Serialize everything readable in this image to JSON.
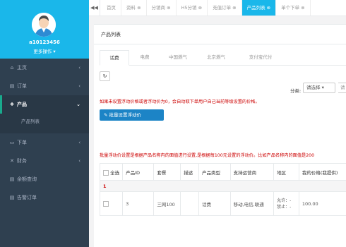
{
  "sidebar": {
    "username": "a10123456",
    "more_ops": "更多操作 ▾",
    "items": [
      {
        "icon": "home-icon",
        "glyph": "⌂",
        "label": "主页",
        "arrow": "‹"
      },
      {
        "icon": "order-icon",
        "glyph": "▤",
        "label": "订单",
        "arrow": "‹"
      },
      {
        "icon": "cube-icon",
        "glyph": "❖",
        "label": "产品",
        "arrow": "⌄"
      },
      {
        "icon": "download-icon",
        "glyph": "▭",
        "label": "下单",
        "arrow": "‹"
      },
      {
        "icon": "finance-icon",
        "glyph": "✕",
        "label": "财务",
        "arrow": "‹"
      },
      {
        "icon": "balance-icon",
        "glyph": "▤",
        "label": "余额查询",
        "arrow": ""
      },
      {
        "icon": "alert-icon",
        "glyph": "▤",
        "label": "告警订单",
        "arrow": ""
      }
    ],
    "sub_item": "产品列表"
  },
  "tabbar": {
    "back_glyph": "◀◀",
    "tabs": [
      {
        "label": "首页"
      },
      {
        "label": "资料 ⊗"
      },
      {
        "label": "分销商 ⊗"
      },
      {
        "label": "H5分销 ⊗"
      },
      {
        "label": "充值订单 ⊗"
      },
      {
        "label": "产品列表 ⊗"
      },
      {
        "label": "单个下单 ⊗"
      }
    ]
  },
  "panel": {
    "title": "产品列表",
    "subtabs": [
      "话费",
      "电费",
      "中国燃气",
      "北京燃气",
      "支付宝代付"
    ],
    "refresh_glyph": "↻",
    "filter_label": "分类:",
    "filter_select": "请选择 ▾",
    "filter_input": "请",
    "notice1": "如果未设置浮动价格或者浮动价为0，会自动取下单用户自己当前等级设置的价格。",
    "float_button": "✎ 批量设置浮动价",
    "notice2": "批量浮动价设置是根据产品名称内的面值进行设置,是根据每100元设置的浮动价。比如产品名称内的面值是200"
  },
  "table": {
    "headers": [
      "全选",
      "产品ID",
      "套餐",
      "描述",
      "产品类型",
      "支持运营商",
      "地区",
      "我的价格(我提供)"
    ],
    "group_label": "1",
    "rows": [
      {
        "id": "3",
        "package": "三网100",
        "desc": "",
        "type": "话费",
        "carriers": "移动,电信,联通",
        "region_line1": "允许：-",
        "region_line2": "禁止：-",
        "price": "100.00"
      }
    ]
  }
}
